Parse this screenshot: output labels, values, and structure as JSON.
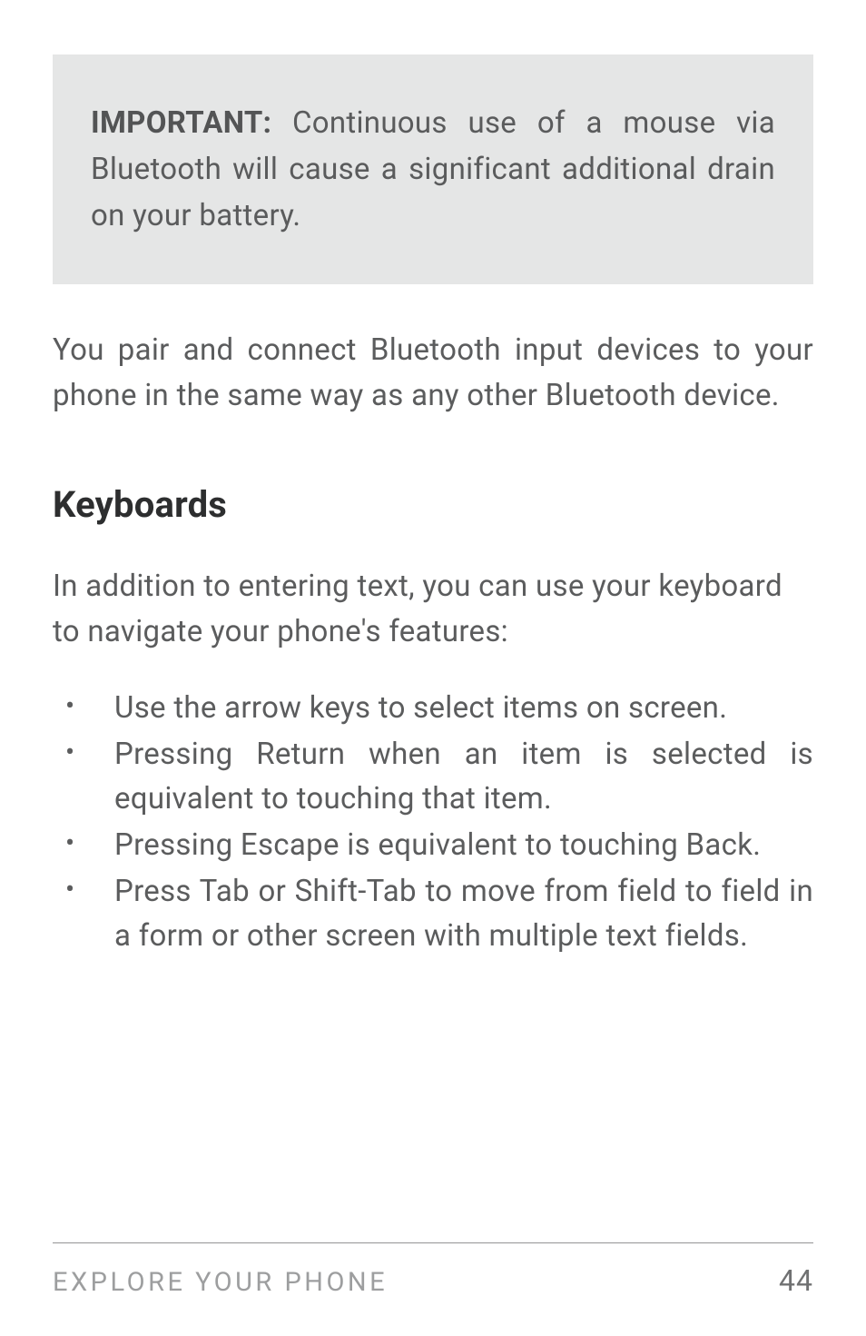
{
  "callout": {
    "label": "IMPORTANT:",
    "text": " Continuous use of a mouse via Bluetooth will cause a significant additional drain on your battery."
  },
  "paragraph1": "You pair and connect Bluetooth input de­vices to your phone in the same way as any other Bluetooth device.",
  "heading": "Keyboards",
  "intro": "In addition to entering text, you can use your keyboard to navigate your phone's features:",
  "bullets": {
    "0": "Use the arrow keys to select items on screen.",
    "1": "Pressing Return when an item is selected is equivalent to touching that item.",
    "2": "Pressing Escape is equivalent to touch­ing Back.",
    "3": "Press Tab or Shift-Tab to move from field to field in a form or other screen with mul­tiple text fields."
  },
  "footer": {
    "title": "EXPLORE YOUR PHONE",
    "page": "44"
  }
}
